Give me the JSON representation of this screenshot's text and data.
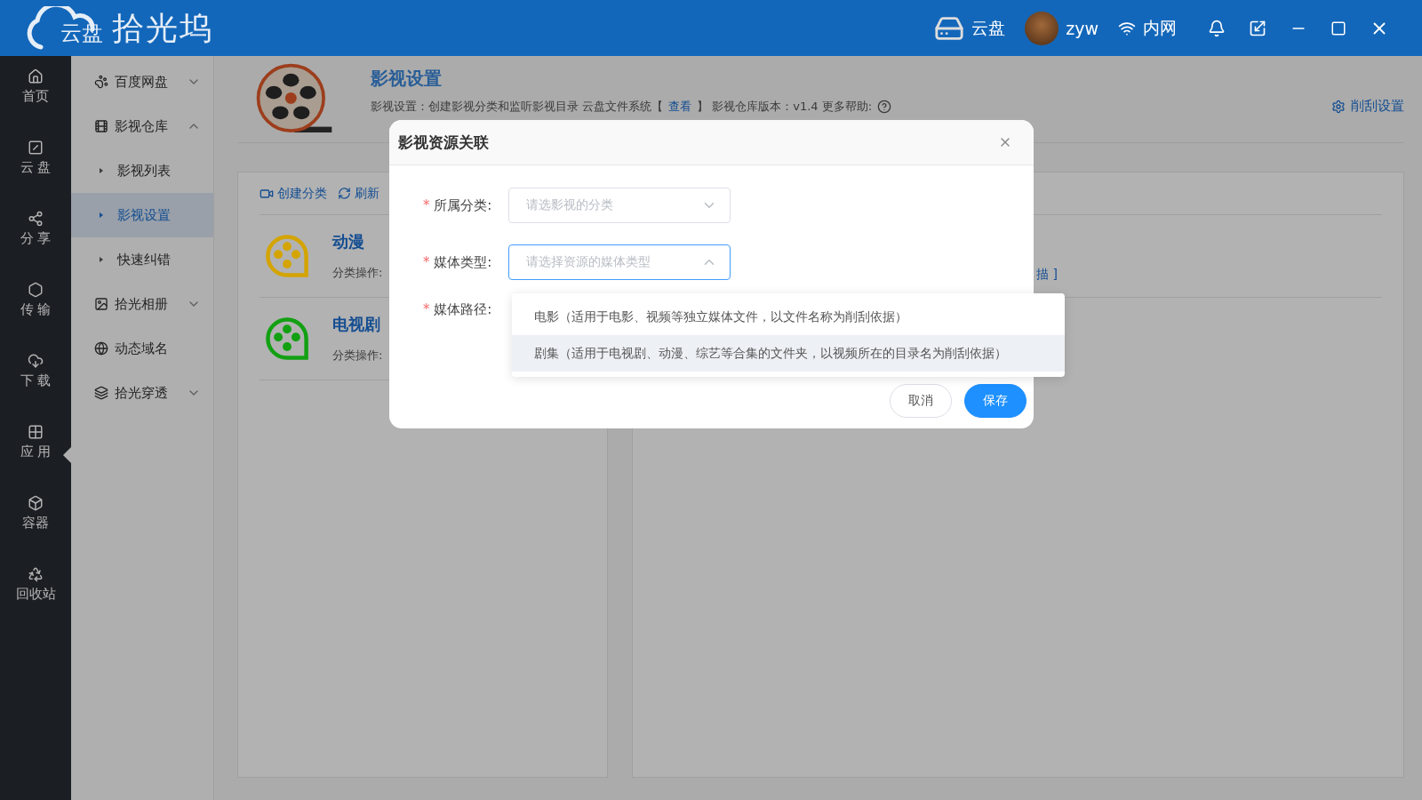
{
  "titlebar": {
    "logo_badge": "云盘",
    "logo_text": "拾光坞",
    "drive_label": "云盘",
    "user": "zyw",
    "network": "内网"
  },
  "nav": [
    {
      "label": "首页",
      "selected": false
    },
    {
      "label": "云 盘",
      "selected": false
    },
    {
      "label": "分 享",
      "selected": false
    },
    {
      "label": "传 输",
      "selected": false
    },
    {
      "label": "下 载",
      "selected": false
    },
    {
      "label": "应 用",
      "selected": true
    },
    {
      "label": "容器",
      "selected": false
    },
    {
      "label": "回收站",
      "selected": false
    }
  ],
  "submenu": [
    {
      "label": "百度网盘",
      "expanded": false,
      "selected": false
    },
    {
      "label": "影视仓库",
      "expanded": true,
      "selected": false,
      "children": [
        {
          "label": "影视列表",
          "selected": false
        },
        {
          "label": "影视设置",
          "selected": true
        },
        {
          "label": "快速纠错",
          "selected": false
        }
      ]
    },
    {
      "label": "拾光相册",
      "expanded": false,
      "selected": false
    },
    {
      "label": "动态域名",
      "selected": false
    },
    {
      "label": "拾光穿透",
      "expanded": false,
      "selected": false
    }
  ],
  "header": {
    "title": "影视设置",
    "description_before": "影视设置：创建影视分类和监听影视目录 云盘文件系统【",
    "description_link": "查看",
    "description_after": "】 影视仓库版本：v1.4 更多帮助:",
    "settings_link": "削刮设置"
  },
  "toolbar": [
    "创建分类",
    "刷新"
  ],
  "categories": [
    {
      "name": "动漫",
      "caption": "分类操作:",
      "color": "#d4a400"
    },
    {
      "name": "电视剧",
      "caption": "分类操作:",
      "color": "#12a012"
    }
  ],
  "right_fragment": "描 ]",
  "dialog": {
    "title": "影视资源关联",
    "fields": [
      {
        "mark": "*",
        "label": "所属分类:",
        "placeholder": "请选影视的分类",
        "open": false
      },
      {
        "mark": "*",
        "label": "媒体类型:",
        "placeholder": "请选择资源的媒体类型",
        "open": true
      },
      {
        "mark": "*",
        "label": "媒体路径:"
      }
    ],
    "options": [
      {
        "label": "电影（适用于电影、视频等独立媒体文件，以文件名称为削刮依据）",
        "highlighted": false
      },
      {
        "label": "剧集（适用于电视剧、动漫、综艺等合集的文件夹，以视频所在的目录名为削刮依据）",
        "highlighted": true
      }
    ],
    "buttons": [
      {
        "label": "取消",
        "kind": "plain"
      },
      {
        "label": "保存",
        "kind": "primary"
      }
    ]
  }
}
